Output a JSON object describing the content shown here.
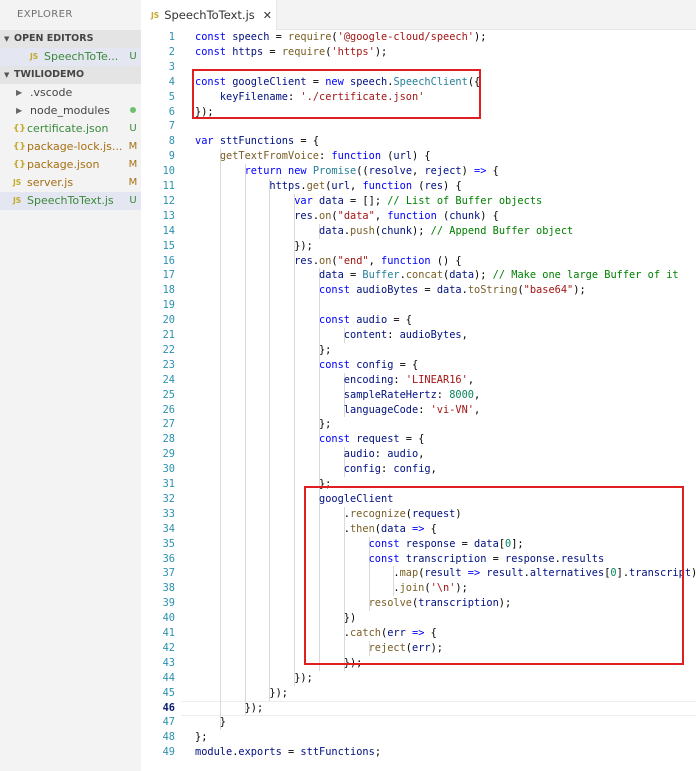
{
  "sidebar": {
    "title": "EXPLORER",
    "open_editors": {
      "label": "OPEN EDITORS",
      "files": [
        {
          "icon": "js-file-icon",
          "name": "SpeechToTe...",
          "status": "U"
        }
      ]
    },
    "project": {
      "label": "TWILIODEMO",
      "items": [
        {
          "type": "folder",
          "name": ".vscode",
          "status": ""
        },
        {
          "type": "folder",
          "name": "node_modules",
          "status": "dot"
        },
        {
          "type": "json",
          "name": "certificate.json",
          "status": "U"
        },
        {
          "type": "json",
          "name": "package-lock.js...",
          "status": "M"
        },
        {
          "type": "json",
          "name": "package.json",
          "status": "M"
        },
        {
          "type": "js",
          "name": "server.js",
          "status": "M"
        },
        {
          "type": "js",
          "name": "SpeechToText.js",
          "status": "U"
        }
      ]
    }
  },
  "tab": {
    "icon_text": "JS",
    "name": "SpeechToText.js",
    "close": "✕"
  },
  "icons": {
    "js": "JS",
    "json": "{}"
  },
  "editor": {
    "current_line": 46,
    "lines": [
      {
        "n": 1,
        "t": [
          [
            "kw",
            "const "
          ],
          [
            "id",
            "speech"
          ],
          [
            "pl",
            " = "
          ],
          [
            "fn",
            "require"
          ],
          [
            "pl",
            "("
          ],
          [
            "str",
            "'@google-cloud/speech'"
          ],
          [
            "pl",
            ");"
          ]
        ]
      },
      {
        "n": 2,
        "t": [
          [
            "kw",
            "const "
          ],
          [
            "id",
            "https"
          ],
          [
            "pl",
            " = "
          ],
          [
            "fn",
            "require"
          ],
          [
            "pl",
            "("
          ],
          [
            "str",
            "'https'"
          ],
          [
            "pl",
            ");"
          ]
        ]
      },
      {
        "n": 3,
        "t": []
      },
      {
        "n": 4,
        "t": [
          [
            "kw",
            "const "
          ],
          [
            "id",
            "googleClient"
          ],
          [
            "pl",
            " = "
          ],
          [
            "kw",
            "new "
          ],
          [
            "id",
            "speech"
          ],
          [
            "pl",
            "."
          ],
          [
            "cls",
            "SpeechClient"
          ],
          [
            "pl",
            "({"
          ]
        ]
      },
      {
        "n": 5,
        "t": [
          [
            "pl",
            "    "
          ],
          [
            "id",
            "keyFilename"
          ],
          [
            "pl",
            ": "
          ],
          [
            "str",
            "'./certificate.json'"
          ]
        ]
      },
      {
        "n": 6,
        "t": [
          [
            "pl",
            "});"
          ]
        ]
      },
      {
        "n": 7,
        "t": []
      },
      {
        "n": 8,
        "t": [
          [
            "kw",
            "var "
          ],
          [
            "id",
            "sttFunctions"
          ],
          [
            "pl",
            " = {"
          ]
        ]
      },
      {
        "n": 9,
        "t": [
          [
            "pl",
            "    "
          ],
          [
            "fn",
            "getTextFromVoice"
          ],
          [
            "pl",
            ": "
          ],
          [
            "kw",
            "function "
          ],
          [
            "pl",
            "("
          ],
          [
            "id",
            "url"
          ],
          [
            "pl",
            ") {"
          ]
        ]
      },
      {
        "n": 10,
        "t": [
          [
            "pl",
            "        "
          ],
          [
            "kw",
            "return new "
          ],
          [
            "cls",
            "Promise"
          ],
          [
            "pl",
            "(("
          ],
          [
            "id",
            "resolve"
          ],
          [
            "pl",
            ", "
          ],
          [
            "id",
            "reject"
          ],
          [
            "pl",
            ") "
          ],
          [
            "kw",
            "=>"
          ],
          [
            "pl",
            " {"
          ]
        ]
      },
      {
        "n": 11,
        "t": [
          [
            "pl",
            "            "
          ],
          [
            "id",
            "https"
          ],
          [
            "pl",
            "."
          ],
          [
            "fn",
            "get"
          ],
          [
            "pl",
            "("
          ],
          [
            "id",
            "url"
          ],
          [
            "pl",
            ", "
          ],
          [
            "kw",
            "function "
          ],
          [
            "pl",
            "("
          ],
          [
            "id",
            "res"
          ],
          [
            "pl",
            ") {"
          ]
        ]
      },
      {
        "n": 12,
        "t": [
          [
            "pl",
            "                "
          ],
          [
            "kw",
            "var "
          ],
          [
            "id",
            "data"
          ],
          [
            "pl",
            " = []; "
          ],
          [
            "com",
            "// List of Buffer objects"
          ]
        ]
      },
      {
        "n": 13,
        "t": [
          [
            "pl",
            "                "
          ],
          [
            "id",
            "res"
          ],
          [
            "pl",
            "."
          ],
          [
            "fn",
            "on"
          ],
          [
            "pl",
            "("
          ],
          [
            "str",
            "\"data\""
          ],
          [
            "pl",
            ", "
          ],
          [
            "kw",
            "function "
          ],
          [
            "pl",
            "("
          ],
          [
            "id",
            "chunk"
          ],
          [
            "pl",
            ") {"
          ]
        ]
      },
      {
        "n": 14,
        "t": [
          [
            "pl",
            "                    "
          ],
          [
            "id",
            "data"
          ],
          [
            "pl",
            "."
          ],
          [
            "fn",
            "push"
          ],
          [
            "pl",
            "("
          ],
          [
            "id",
            "chunk"
          ],
          [
            "pl",
            "); "
          ],
          [
            "com",
            "// Append Buffer object"
          ]
        ]
      },
      {
        "n": 15,
        "t": [
          [
            "pl",
            "                });"
          ]
        ]
      },
      {
        "n": 16,
        "t": [
          [
            "pl",
            "                "
          ],
          [
            "id",
            "res"
          ],
          [
            "pl",
            "."
          ],
          [
            "fn",
            "on"
          ],
          [
            "pl",
            "("
          ],
          [
            "str",
            "\"end\""
          ],
          [
            "pl",
            ", "
          ],
          [
            "kw",
            "function "
          ],
          [
            "pl",
            "() {"
          ]
        ]
      },
      {
        "n": 17,
        "t": [
          [
            "pl",
            "                    "
          ],
          [
            "id",
            "data"
          ],
          [
            "pl",
            " = "
          ],
          [
            "cls",
            "Buffer"
          ],
          [
            "pl",
            "."
          ],
          [
            "fn",
            "concat"
          ],
          [
            "pl",
            "("
          ],
          [
            "id",
            "data"
          ],
          [
            "pl",
            "); "
          ],
          [
            "com",
            "// Make one large Buffer of it"
          ]
        ]
      },
      {
        "n": 18,
        "t": [
          [
            "pl",
            "                    "
          ],
          [
            "kw",
            "const "
          ],
          [
            "id",
            "audioBytes"
          ],
          [
            "pl",
            " = "
          ],
          [
            "id",
            "data"
          ],
          [
            "pl",
            "."
          ],
          [
            "fn",
            "toString"
          ],
          [
            "pl",
            "("
          ],
          [
            "str",
            "\"base64\""
          ],
          [
            "pl",
            ");"
          ]
        ]
      },
      {
        "n": 19,
        "t": []
      },
      {
        "n": 20,
        "t": [
          [
            "pl",
            "                    "
          ],
          [
            "kw",
            "const "
          ],
          [
            "id",
            "audio"
          ],
          [
            "pl",
            " = {"
          ]
        ]
      },
      {
        "n": 21,
        "t": [
          [
            "pl",
            "                        "
          ],
          [
            "id",
            "content"
          ],
          [
            "pl",
            ": "
          ],
          [
            "id",
            "audioBytes"
          ],
          [
            "pl",
            ","
          ]
        ]
      },
      {
        "n": 22,
        "t": [
          [
            "pl",
            "                    };"
          ]
        ]
      },
      {
        "n": 23,
        "t": [
          [
            "pl",
            "                    "
          ],
          [
            "kw",
            "const "
          ],
          [
            "id",
            "config"
          ],
          [
            "pl",
            " = {"
          ]
        ]
      },
      {
        "n": 24,
        "t": [
          [
            "pl",
            "                        "
          ],
          [
            "id",
            "encoding"
          ],
          [
            "pl",
            ": "
          ],
          [
            "str",
            "'LINEAR16'"
          ],
          [
            "pl",
            ","
          ]
        ]
      },
      {
        "n": 25,
        "t": [
          [
            "pl",
            "                        "
          ],
          [
            "id",
            "sampleRateHertz"
          ],
          [
            "pl",
            ": "
          ],
          [
            "num",
            "8000"
          ],
          [
            "pl",
            ","
          ]
        ]
      },
      {
        "n": 26,
        "t": [
          [
            "pl",
            "                        "
          ],
          [
            "id",
            "languageCode"
          ],
          [
            "pl",
            ": "
          ],
          [
            "str",
            "'vi-VN'"
          ],
          [
            "pl",
            ","
          ]
        ]
      },
      {
        "n": 27,
        "t": [
          [
            "pl",
            "                    };"
          ]
        ]
      },
      {
        "n": 28,
        "t": [
          [
            "pl",
            "                    "
          ],
          [
            "kw",
            "const "
          ],
          [
            "id",
            "request"
          ],
          [
            "pl",
            " = {"
          ]
        ]
      },
      {
        "n": 29,
        "t": [
          [
            "pl",
            "                        "
          ],
          [
            "id",
            "audio"
          ],
          [
            "pl",
            ": "
          ],
          [
            "id",
            "audio"
          ],
          [
            "pl",
            ","
          ]
        ]
      },
      {
        "n": 30,
        "t": [
          [
            "pl",
            "                        "
          ],
          [
            "id",
            "config"
          ],
          [
            "pl",
            ": "
          ],
          [
            "id",
            "config"
          ],
          [
            "pl",
            ","
          ]
        ]
      },
      {
        "n": 31,
        "t": [
          [
            "pl",
            "                    };"
          ]
        ]
      },
      {
        "n": 32,
        "t": [
          [
            "pl",
            "                    "
          ],
          [
            "id",
            "googleClient"
          ]
        ]
      },
      {
        "n": 33,
        "t": [
          [
            "pl",
            "                        ."
          ],
          [
            "fn",
            "recognize"
          ],
          [
            "pl",
            "("
          ],
          [
            "id",
            "request"
          ],
          [
            "pl",
            ")"
          ]
        ]
      },
      {
        "n": 34,
        "t": [
          [
            "pl",
            "                        ."
          ],
          [
            "fn",
            "then"
          ],
          [
            "pl",
            "("
          ],
          [
            "id",
            "data"
          ],
          [
            "pl",
            " "
          ],
          [
            "kw",
            "=>"
          ],
          [
            "pl",
            " {"
          ]
        ]
      },
      {
        "n": 35,
        "t": [
          [
            "pl",
            "                            "
          ],
          [
            "kw",
            "const "
          ],
          [
            "id",
            "response"
          ],
          [
            "pl",
            " = "
          ],
          [
            "id",
            "data"
          ],
          [
            "pl",
            "["
          ],
          [
            "num",
            "0"
          ],
          [
            "pl",
            "];"
          ]
        ]
      },
      {
        "n": 36,
        "t": [
          [
            "pl",
            "                            "
          ],
          [
            "kw",
            "const "
          ],
          [
            "id",
            "transcription"
          ],
          [
            "pl",
            " = "
          ],
          [
            "id",
            "response"
          ],
          [
            "pl",
            "."
          ],
          [
            "id",
            "results"
          ]
        ]
      },
      {
        "n": 37,
        "t": [
          [
            "pl",
            "                                ."
          ],
          [
            "fn",
            "map"
          ],
          [
            "pl",
            "("
          ],
          [
            "id",
            "result"
          ],
          [
            "pl",
            " "
          ],
          [
            "kw",
            "=>"
          ],
          [
            "pl",
            " "
          ],
          [
            "id",
            "result"
          ],
          [
            "pl",
            "."
          ],
          [
            "id",
            "alternatives"
          ],
          [
            "pl",
            "["
          ],
          [
            "num",
            "0"
          ],
          [
            "pl",
            "]."
          ],
          [
            "id",
            "transcript"
          ],
          [
            "pl",
            ")"
          ]
        ]
      },
      {
        "n": 38,
        "t": [
          [
            "pl",
            "                                ."
          ],
          [
            "fn",
            "join"
          ],
          [
            "pl",
            "("
          ],
          [
            "str",
            "'\\n'"
          ],
          [
            "pl",
            ");"
          ]
        ]
      },
      {
        "n": 39,
        "t": [
          [
            "pl",
            "                            "
          ],
          [
            "fn",
            "resolve"
          ],
          [
            "pl",
            "("
          ],
          [
            "id",
            "transcription"
          ],
          [
            "pl",
            ");"
          ]
        ]
      },
      {
        "n": 40,
        "t": [
          [
            "pl",
            "                        })"
          ]
        ]
      },
      {
        "n": 41,
        "t": [
          [
            "pl",
            "                        ."
          ],
          [
            "fn",
            "catch"
          ],
          [
            "pl",
            "("
          ],
          [
            "id",
            "err"
          ],
          [
            "pl",
            " "
          ],
          [
            "kw",
            "=>"
          ],
          [
            "pl",
            " {"
          ]
        ]
      },
      {
        "n": 42,
        "t": [
          [
            "pl",
            "                            "
          ],
          [
            "fn",
            "reject"
          ],
          [
            "pl",
            "("
          ],
          [
            "id",
            "err"
          ],
          [
            "pl",
            ");"
          ]
        ]
      },
      {
        "n": 43,
        "t": [
          [
            "pl",
            "                        });"
          ]
        ]
      },
      {
        "n": 44,
        "t": [
          [
            "pl",
            "                });"
          ]
        ]
      },
      {
        "n": 45,
        "t": [
          [
            "pl",
            "            });"
          ]
        ]
      },
      {
        "n": 46,
        "t": [
          [
            "pl",
            "        });"
          ]
        ]
      },
      {
        "n": 47,
        "t": [
          [
            "pl",
            "    }"
          ]
        ]
      },
      {
        "n": 48,
        "t": [
          [
            "pl",
            "};"
          ]
        ]
      },
      {
        "n": 49,
        "t": [
          [
            "id",
            "module"
          ],
          [
            "pl",
            "."
          ],
          [
            "id",
            "exports"
          ],
          [
            "pl",
            " = "
          ],
          [
            "id",
            "sttFunctions"
          ],
          [
            "pl",
            ";"
          ]
        ]
      }
    ]
  },
  "highlight_color": "#e02020"
}
